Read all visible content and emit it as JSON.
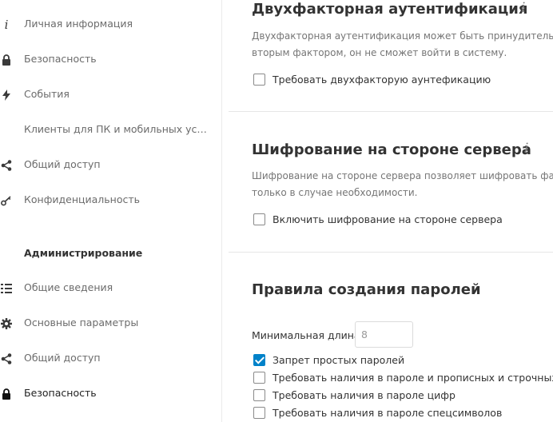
{
  "sidebar": {
    "personal_items": [
      {
        "label": "Личная информация",
        "icon": "info-icon"
      },
      {
        "label": "Безопасность",
        "icon": "lock-icon"
      },
      {
        "label": "События",
        "icon": "lightning-icon"
      },
      {
        "label": "Клиенты для ПК и мобильных устройств",
        "icon": ""
      },
      {
        "label": "Общий доступ",
        "icon": "share-icon"
      },
      {
        "label": "Конфиденциальность",
        "icon": "key-icon"
      }
    ],
    "admin_heading": "Администрирование",
    "admin_items": [
      {
        "label": "Общие сведения",
        "icon": "list-icon"
      },
      {
        "label": "Основные параметры",
        "icon": "gear-icon"
      },
      {
        "label": "Общий доступ",
        "icon": "share-icon"
      },
      {
        "label": "Безопасность",
        "icon": "lock-icon",
        "active": true
      }
    ]
  },
  "main": {
    "twofactor": {
      "title": "Двухфакторная аутентификация",
      "info_glyph": "i",
      "desc_line1": "Двухфакторная аутентификация может быть принудительна вкл",
      "desc_line2": "вторым фактором, он не сможет войти в систему.",
      "checkbox_label": "Требовать двухфакторую аунтефикацию",
      "checked": false
    },
    "encryption": {
      "title": "Шифрование на стороне сервера",
      "info_glyph": "i",
      "desc_line1": "Шифрование на стороне сервера позволяет шифровать файл",
      "desc_line2": "только в случае необходимости.",
      "checkbox_label": "Включить шифрование на стороне сервера",
      "checked": false
    },
    "password_policy": {
      "title": "Правила создания паролей",
      "min_length_label": "Минимальная длина",
      "min_length_value": "8",
      "options": [
        {
          "label": "Запрет простых паролей",
          "checked": true
        },
        {
          "label": "Требовать наличия в пароле и прописных и строчных бук",
          "checked": false
        },
        {
          "label": "Требовать наличия в пароле цифр",
          "checked": false
        },
        {
          "label": "Требовать наличия в пароле спецсимволов",
          "checked": false
        }
      ]
    }
  },
  "colors": {
    "accent": "#0082c9",
    "text": "#333333",
    "muted": "#767676"
  }
}
